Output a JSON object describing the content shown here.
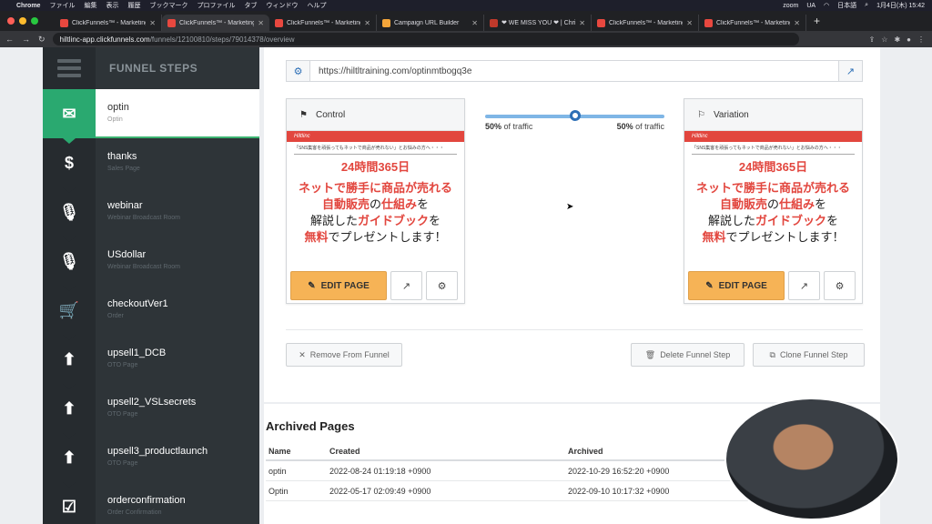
{
  "menubar": {
    "app": "Chrome",
    "items": [
      "ファイル",
      "編集",
      "表示",
      "履歴",
      "ブックマーク",
      "プロファイル",
      "タブ",
      "ウィンドウ",
      "ヘルプ"
    ],
    "zoom": "zoom",
    "ua": "UA",
    "lang": "日本語",
    "datetime": "1月4日(木) 15:42"
  },
  "browser": {
    "tabs": [
      {
        "title": "ClickFunnels™ - Marketing Fu",
        "active": false,
        "fav": "#e8483f"
      },
      {
        "title": "ClickFunnels™ - Marketing Fu",
        "active": true,
        "fav": "#e8483f"
      },
      {
        "title": "ClickFunnels™ - Marketing Fu",
        "active": false,
        "fav": "#e8483f"
      },
      {
        "title": "Campaign URL Builder",
        "active": false,
        "fav": "#f4a53a"
      },
      {
        "title": "❤ WE MISS YOU ❤ | Christi",
        "active": false,
        "fav": "#c0392b"
      },
      {
        "title": "ClickFunnels™ - Marketing Fu",
        "active": false,
        "fav": "#e8483f"
      },
      {
        "title": "ClickFunnels™ - Marketing Fu",
        "active": false,
        "fav": "#e8483f"
      }
    ],
    "url_host": "hiltlinc-app.clickfunnels.com",
    "url_path": "/funnels/12100810/steps/79014378/overview"
  },
  "sidebar": {
    "title": "FUNNEL STEPS",
    "steps": [
      {
        "name": "optin",
        "sub": "Optin",
        "icon": "envelope-icon",
        "glyph": "✉",
        "active": true
      },
      {
        "name": "thanks",
        "sub": "Sales Page",
        "icon": "dollar-icon",
        "glyph": "$",
        "active": false
      },
      {
        "name": "webinar",
        "sub": "Webinar Broadcast Room",
        "icon": "microphone-icon",
        "glyph": "🎙",
        "active": false
      },
      {
        "name": "USdollar",
        "sub": "Webinar Broadcast Room",
        "icon": "microphone-icon",
        "glyph": "🎙",
        "active": false
      },
      {
        "name": "checkoutVer1",
        "sub": "Order",
        "icon": "cart-icon",
        "glyph": "🛒",
        "active": false
      },
      {
        "name": "upsell1_DCB",
        "sub": "OTO Page",
        "icon": "arrow-up-icon",
        "glyph": "⬆",
        "active": false
      },
      {
        "name": "upsell2_VSLsecrets",
        "sub": "OTO Page",
        "icon": "arrow-up-icon",
        "glyph": "⬆",
        "active": false
      },
      {
        "name": "upsell3_productlaunch",
        "sub": "OTO Page",
        "icon": "arrow-up-icon",
        "glyph": "⬆",
        "active": false
      },
      {
        "name": "orderconfirmation",
        "sub": "Order Confirmation",
        "icon": "checkbox-icon",
        "glyph": "☑",
        "active": false
      }
    ]
  },
  "main": {
    "page_url": "https://hiltltraining.com/optinmtbogq3e",
    "control": {
      "label": "Control",
      "edit_label": "EDIT PAGE"
    },
    "variation": {
      "label": "Variation",
      "edit_label": "EDIT PAGE"
    },
    "preview": {
      "logo": "Hiltlinc",
      "tagline": "「SNS集客を頑張ってもネットで商品が売れない」とお悩みの方へ・・・",
      "line1": "24時間365日",
      "line2": "ネットで勝手に商品が売れる",
      "line3_red1": "自動販売",
      "line3_mid": "の",
      "line3_red2": "仕組み",
      "line3_end": "を",
      "line4_start": "解説した",
      "line4_red": "ガイドブック",
      "line4_end": "を",
      "line5_red": "無料",
      "line5_end": "でプレゼントします！"
    },
    "traffic": {
      "left_pct": "50%",
      "right_pct": "50%",
      "suffix": "of traffic",
      "split_fraction": 0.5
    },
    "remove_label": "Remove From Funnel",
    "delete_label": "Delete Funnel Step",
    "clone_label": "Clone Funnel Step"
  },
  "archive": {
    "title": "Archived Pages",
    "columns": [
      "Name",
      "Created",
      "Archived"
    ],
    "rows": [
      [
        "optin",
        "2022-08-24 01:19:18 +0900",
        "2022-10-29 16:52:20 +0900"
      ],
      [
        "Optin",
        "2022-05-17 02:09:49 +0900",
        "2022-09-10 10:17:32 +0900"
      ]
    ]
  },
  "colors": {
    "sidebar_bg": "#2e3438",
    "active_green": "#2aa970",
    "edit_orange": "#f6b356",
    "accent_blue": "#2d6fb6",
    "preview_red": "#e2463e"
  }
}
